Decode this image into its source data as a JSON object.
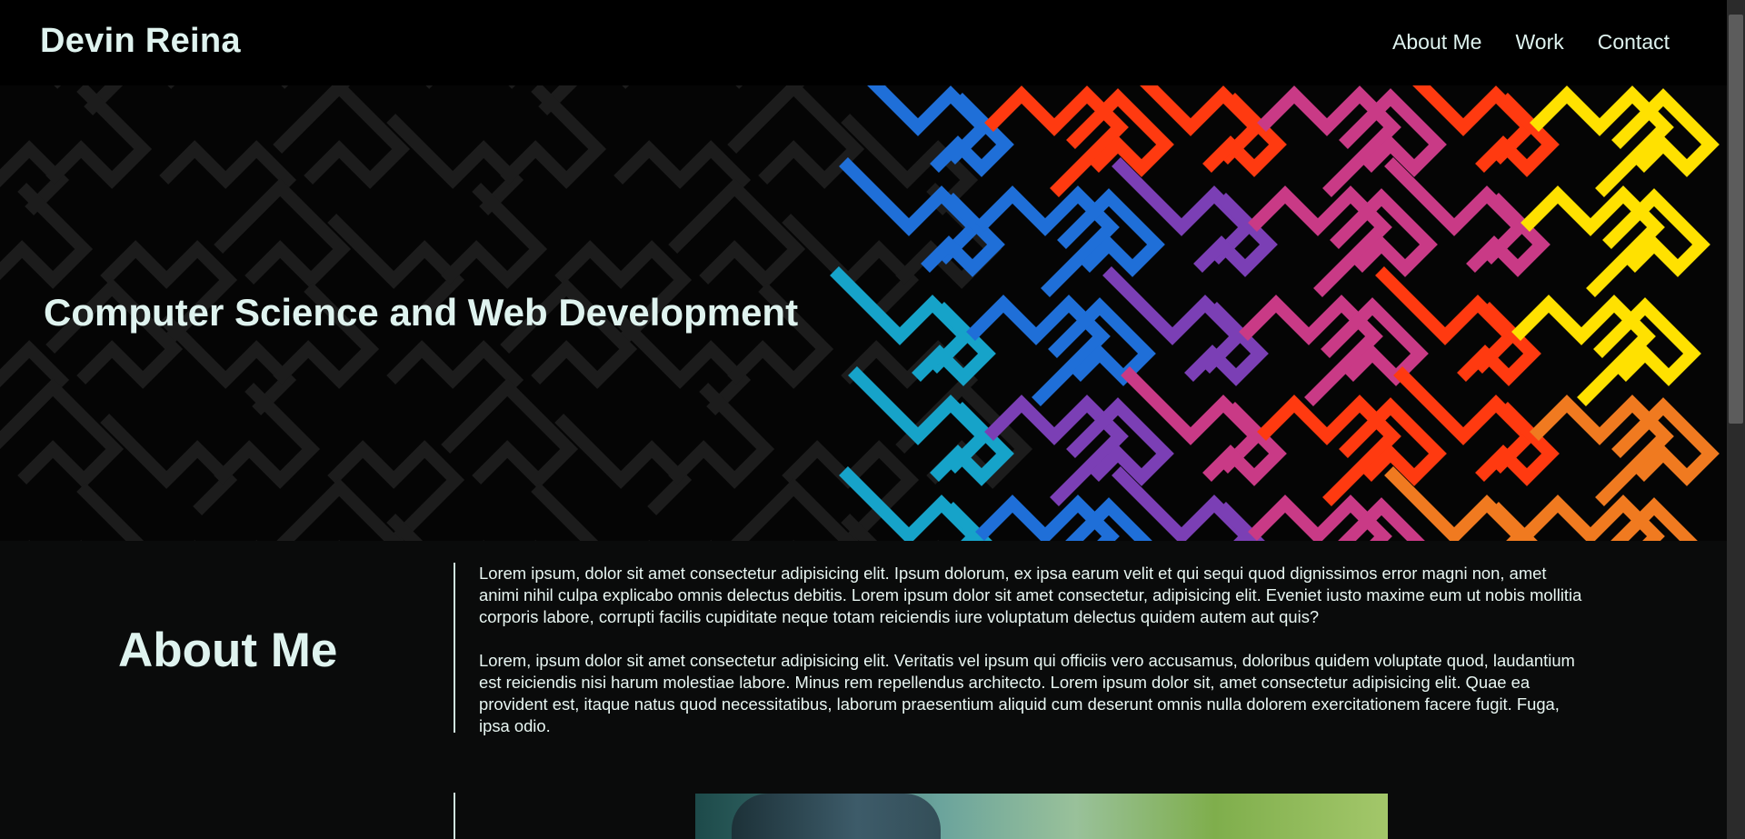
{
  "site": {
    "brand": "Devin Reina"
  },
  "nav": {
    "items": [
      {
        "label": "About Me"
      },
      {
        "label": "Work"
      },
      {
        "label": "Contact"
      }
    ]
  },
  "hero": {
    "tagline": "Computer Science and Web Development",
    "colors": [
      "#1f6fd8",
      "#16a3c9",
      "#7b3fb5",
      "#c93a86",
      "#ff3a10",
      "#ffe100",
      "#f07a20"
    ]
  },
  "about": {
    "heading": "About Me",
    "paragraphs": [
      "Lorem ipsum, dolor sit amet consectetur adipisicing elit. Ipsum dolorum, ex ipsa earum velit et qui sequi quod dignissimos error magni non, amet animi nihil culpa explicabo omnis delectus debitis. Lorem ipsum dolor sit amet consectetur, adipisicing elit. Eveniet iusto maxime eum ut nobis mollitia corporis labore, corrupti facilis cupiditate neque totam reiciendis iure voluptatum delectus quidem autem aut quis?",
      "Lorem, ipsum dolor sit amet consectetur adipisicing elit. Veritatis vel ipsum qui officiis vero accusamus, doloribus quidem voluptate quod, laudantium est reiciendis nisi harum molestiae labore. Minus rem repellendus architecto. Lorem ipsum dolor sit, amet consectetur adipisicing elit. Quae ea provident est, itaque natus quod necessitatibus, laborum praesentium aliquid cum deserunt omnis nulla dolorem exercitationem facere fugit. Fuga, ipsa odio."
    ]
  }
}
